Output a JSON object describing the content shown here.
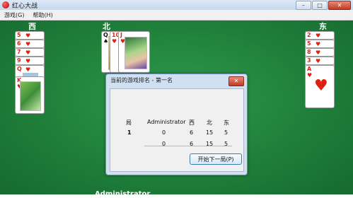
{
  "window": {
    "title": "红心大战",
    "menu": [
      "游戏(G)",
      "帮助(H)"
    ],
    "controls": {
      "minimize": "–",
      "maximize": "□",
      "close": "✕"
    }
  },
  "table": {
    "seats": {
      "west": "西",
      "north": "北",
      "east": "东"
    },
    "west_cards": [
      {
        "rank": "5",
        "suit": "♥"
      },
      {
        "rank": "6",
        "suit": "♥"
      },
      {
        "rank": "7",
        "suit": "♥"
      },
      {
        "rank": "9",
        "suit": "♥"
      },
      {
        "rank": "Q",
        "suit": "♥"
      },
      {
        "rank": "K",
        "suit": "♥"
      }
    ],
    "north_cards": [
      {
        "rank": "Q",
        "suit": "♠"
      },
      {
        "rank": "10",
        "suit": "♥"
      },
      {
        "rank": "J",
        "suit": "♥"
      }
    ],
    "east_cards": [
      {
        "rank": "2",
        "suit": "♥"
      },
      {
        "rank": "5",
        "suit": "♥"
      },
      {
        "rank": "8",
        "suit": "♥"
      },
      {
        "rank": "3",
        "suit": "♥"
      },
      {
        "rank": "A",
        "suit": "♥"
      }
    ],
    "player_name_ghost": "Administrator"
  },
  "dialog": {
    "title": "当前的游戏排名 - 第一名",
    "close": "✕",
    "headers": [
      "局",
      "Administrator",
      "西",
      "北",
      "东"
    ],
    "rounds": [
      [
        "1",
        "0",
        "6",
        "15",
        "5"
      ]
    ],
    "totals": [
      "",
      "0",
      "6",
      "15",
      "5"
    ],
    "button_label": "开始下一局(P)"
  },
  "colors": {
    "felt": "#1f7a3a",
    "heart": "#dd2211",
    "dialog_frame": "#cfe0f2"
  }
}
